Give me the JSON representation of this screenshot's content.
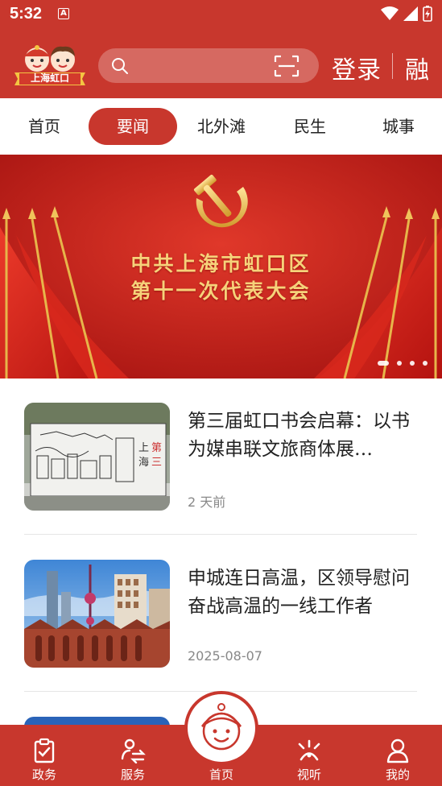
{
  "status_bar": {
    "time": "5:32",
    "a_icon_letter": "A"
  },
  "header": {
    "logo_text": "上海虹口",
    "search_placeholder": "",
    "login_label": "登录",
    "rong_label": "融"
  },
  "tabs": [
    {
      "label": "首页",
      "active": false
    },
    {
      "label": "要闻",
      "active": true
    },
    {
      "label": "北外滩",
      "active": false
    },
    {
      "label": "民生",
      "active": false
    },
    {
      "label": "城事",
      "active": false
    }
  ],
  "banner": {
    "line1": "中共上海市虹口区",
    "line2": "第十一次代表大会",
    "dots": 4,
    "active_dot": 0
  },
  "news": [
    {
      "title": "第三届虹口书会启幕：以书为媒串联文旅商体展…",
      "meta": "2 天前"
    },
    {
      "title": "申城连日高温，区领导慰问奋战高温的一线工作者",
      "meta": "2025-08-07"
    }
  ],
  "bottom_nav": [
    {
      "label": "政务",
      "icon": "clipboard-check-icon"
    },
    {
      "label": "服务",
      "icon": "person-swap-icon"
    },
    {
      "label": "首页",
      "icon": "mascot-icon"
    },
    {
      "label": "视听",
      "icon": "broadcast-icon"
    },
    {
      "label": "我的",
      "icon": "user-icon"
    }
  ],
  "colors": {
    "brand_red": "#c8372d",
    "banner_gold": "#f6d27a"
  }
}
